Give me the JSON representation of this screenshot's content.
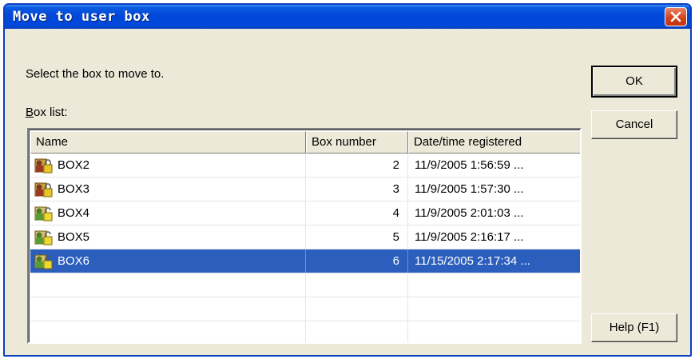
{
  "window": {
    "title": "Move to user box"
  },
  "prompt": "Select the box to move to.",
  "list_label": {
    "accel": "B",
    "rest": "ox list:"
  },
  "columns": [
    "Name",
    "Box number",
    "Date/time registered"
  ],
  "rows": [
    {
      "name": "BOX2",
      "number": "2",
      "date": "11/9/2005 1:56:59 ...",
      "icon": "locked-user-box-icon",
      "selected": false
    },
    {
      "name": "BOX3",
      "number": "3",
      "date": "11/9/2005 1:57:30 ...",
      "icon": "locked-user-box-icon",
      "selected": false
    },
    {
      "name": "BOX4",
      "number": "4",
      "date": "11/9/2005 2:01:03 ...",
      "icon": "user-box-icon",
      "selected": false
    },
    {
      "name": "BOX5",
      "number": "5",
      "date": "11/9/2005 2:16:17 ...",
      "icon": "user-box-icon",
      "selected": false
    },
    {
      "name": "BOX6",
      "number": "6",
      "date": "11/15/2005 2:17:34 ...",
      "icon": "user-box-icon",
      "selected": true
    }
  ],
  "buttons": {
    "ok": "OK",
    "cancel": "Cancel",
    "help": "Help (F1)"
  },
  "colors": {
    "titlebar": "#0046d8",
    "selection": "#2c5fbd",
    "face": "#ece9d8",
    "close": "#d4431e"
  }
}
